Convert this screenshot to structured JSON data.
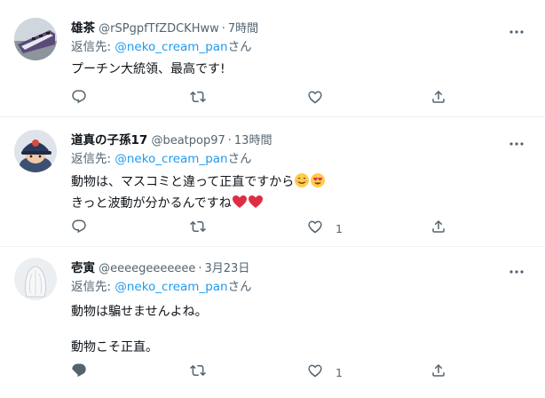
{
  "tweets": [
    {
      "name": "雄茶",
      "handle": "@rSPgpfTfZDCKHww",
      "time": "7時間",
      "reply_prefix": "返信先: ",
      "reply_mention": "@neko_cream_pan",
      "reply_suffix": "さん",
      "lines": [
        "プーチン大統領、最高です!"
      ],
      "like_count": ""
    },
    {
      "name": "道真の子孫17",
      "handle": "@beatpop97",
      "time": "13時間",
      "reply_prefix": "返信先: ",
      "reply_mention": "@neko_cream_pan",
      "reply_suffix": "さん",
      "lines": [
        "動物は、マスコミと違って正直ですから",
        "きっと波動が分かるんですね"
      ],
      "like_count": "1"
    },
    {
      "name": "壱寅",
      "handle": "@eeeegeeeeeee",
      "time": "3月23日",
      "reply_prefix": "返信先: ",
      "reply_mention": "@neko_cream_pan",
      "reply_suffix": "さん",
      "lines": [
        "動物は騙せませんよね。",
        "動物こそ正直。"
      ],
      "like_count": "1"
    }
  ],
  "icons": {
    "reply": "reply-icon",
    "retweet": "retweet-icon",
    "like": "heart-icon",
    "share": "share-icon",
    "more": "more-icon"
  },
  "colors": {
    "text": "#0f1419",
    "secondary": "#536471",
    "link": "#1d9bf0",
    "divider": "#eff3f4"
  }
}
